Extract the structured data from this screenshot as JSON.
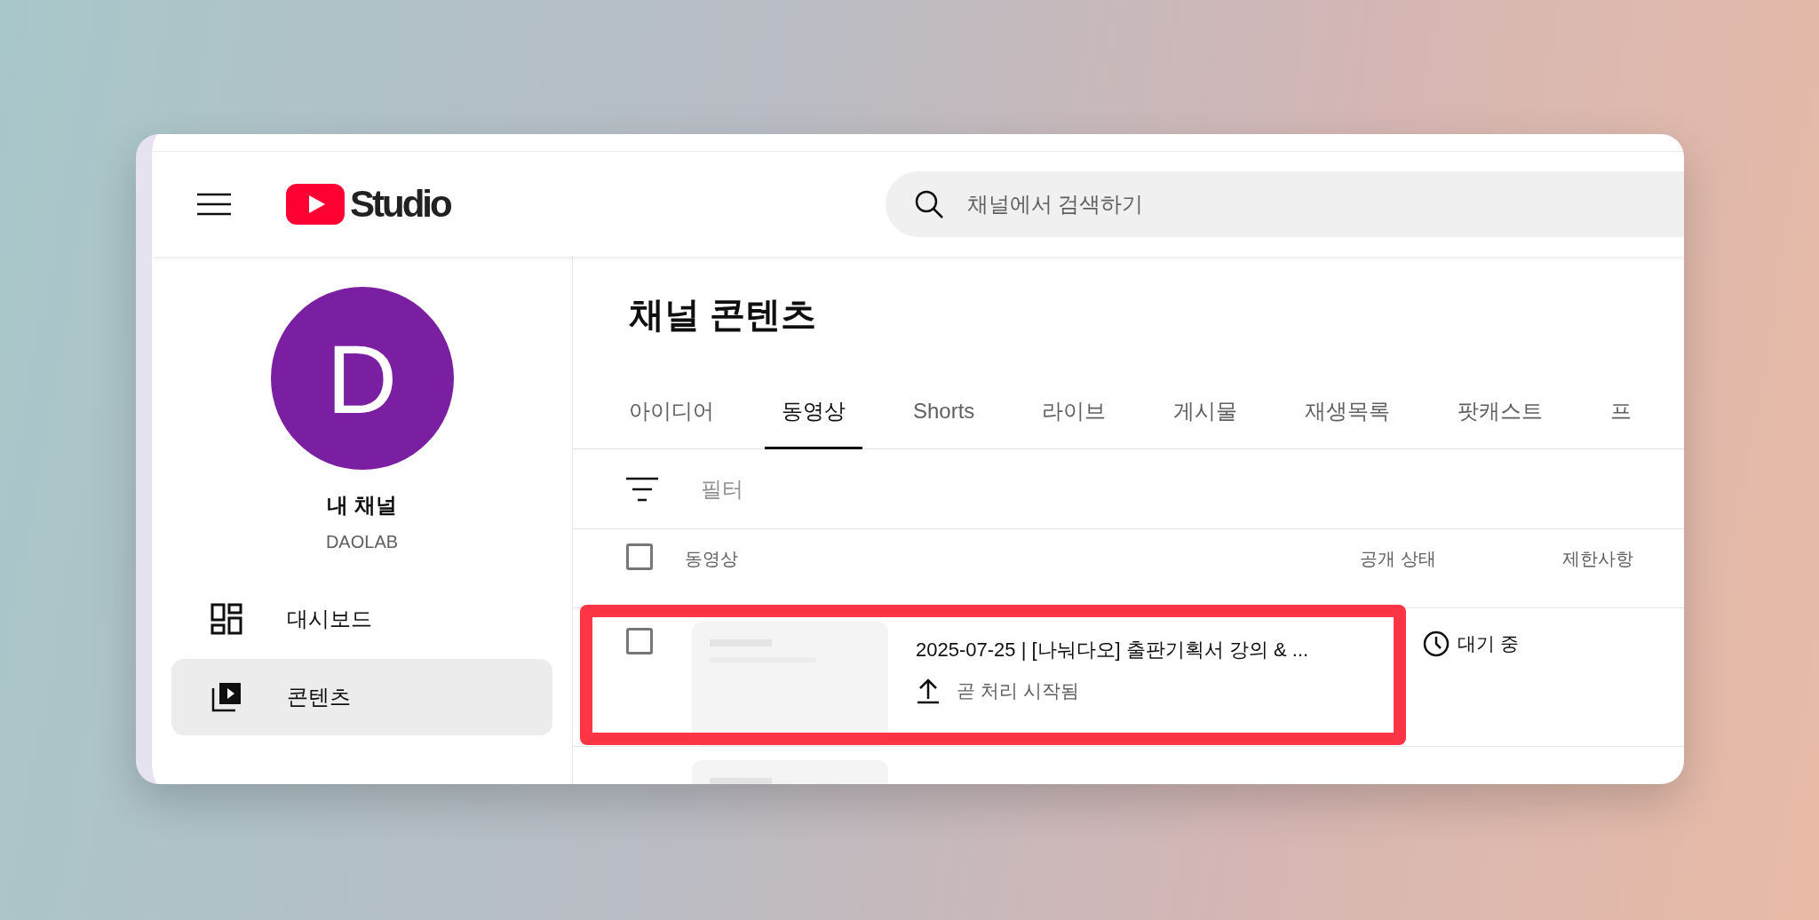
{
  "header": {
    "logo_text": "Studio",
    "search": {
      "placeholder": "채널에서 검색하기"
    }
  },
  "sidebar": {
    "avatar_letter": "D",
    "channel_title": "내 채널",
    "channel_handle": "DAOLAB",
    "items": [
      {
        "kind": "dashboard",
        "label": "대시보드",
        "selected": false
      },
      {
        "kind": "content",
        "label": "콘텐츠",
        "selected": true
      }
    ]
  },
  "main": {
    "title": "채널 콘텐츠",
    "tabs": [
      {
        "label": "아이디어",
        "selected": false
      },
      {
        "label": "동영상",
        "selected": true
      },
      {
        "label": "Shorts",
        "selected": false
      },
      {
        "label": "라이브",
        "selected": false
      },
      {
        "label": "게시물",
        "selected": false
      },
      {
        "label": "재생목록",
        "selected": false
      },
      {
        "label": "팟캐스트",
        "selected": false
      },
      {
        "label": "프",
        "selected": false
      }
    ],
    "filter": {
      "placeholder": "필터"
    },
    "table": {
      "select_all": {
        "checked": false
      },
      "columns": [
        "동영상",
        "공개 상태",
        "제한사항"
      ],
      "rows": [
        {
          "checked": false,
          "title": "2025-07-25 | [나눠다오] 출판기획서 강의 & ...",
          "processing": "곧 처리 시작됨",
          "visibility": "대기 중",
          "highlighted": true
        },
        {
          "highlighted": false
        }
      ]
    }
  }
}
